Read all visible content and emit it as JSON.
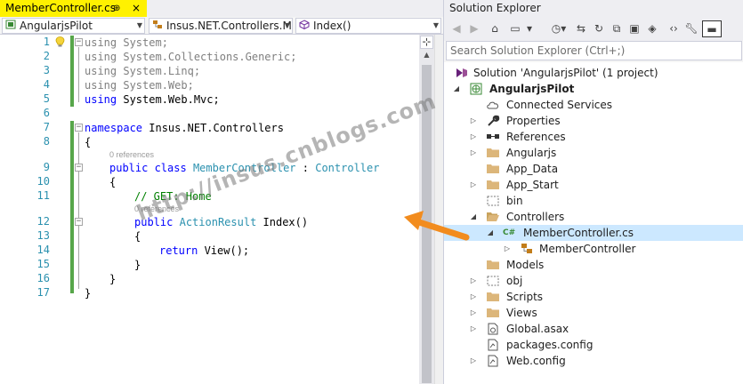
{
  "editor": {
    "tab": {
      "title": "MemberController.cs",
      "pin": "⊕",
      "close": "×"
    },
    "nav": {
      "project": "AngularjsPilot",
      "class": "Insus.NET.Controllers.M",
      "member": "Index()"
    },
    "line_numbers": [
      "1",
      "2",
      "3",
      "4",
      "5",
      "6",
      "7",
      "8",
      "9",
      "10",
      "11",
      "12",
      "13",
      "14",
      "15",
      "16",
      "17"
    ],
    "lines": [
      {
        "n": "1",
        "kind": "using-dim",
        "kw": "using",
        "rest": " System;"
      },
      {
        "n": "2",
        "kind": "using-dim",
        "kw": "using",
        "rest": " System.Collections.Generic;"
      },
      {
        "n": "3",
        "kind": "using-dim",
        "kw": "using",
        "rest": " System.Linq;"
      },
      {
        "n": "4",
        "kind": "using-dim",
        "kw": "using",
        "rest": " System.Web;"
      },
      {
        "n": "5",
        "kind": "using",
        "kw": "using",
        "rest": " System.Web.Mvc;"
      },
      {
        "n": "7",
        "kind": "ns",
        "kw": "namespace",
        "rest": " Insus.NET.Controllers"
      },
      {
        "n": "8",
        "kind": "brace",
        "text": "{"
      },
      {
        "n": "9",
        "kind": "class",
        "kw": "public class",
        "name": "MemberController",
        "sep": " : ",
        "base": "Controller"
      },
      {
        "n": "10",
        "kind": "brace",
        "text": "{"
      },
      {
        "n": "11",
        "kind": "comment",
        "text": "// GET: Home"
      },
      {
        "n": "12",
        "kind": "method",
        "kw": "public",
        "type": "ActionResult",
        "rest": " Index()"
      },
      {
        "n": "13",
        "kind": "brace",
        "text": "{"
      },
      {
        "n": "14",
        "kind": "return",
        "kw": "return",
        "rest": " View();"
      },
      {
        "n": "15",
        "kind": "brace",
        "text": "}"
      },
      {
        "n": "16",
        "kind": "brace",
        "text": "}"
      },
      {
        "n": "17",
        "kind": "brace",
        "text": "}"
      }
    ],
    "references_label": "0 references",
    "fold_minus": "−"
  },
  "solution_explorer": {
    "title": "Solution Explorer",
    "search_placeholder": "Search Solution Explorer (Ctrl+;)",
    "solution_label": "Solution 'AngularjsPilot' (1 project)",
    "project_label": "AngularjsPilot",
    "items": [
      {
        "label": "Connected Services",
        "icon": "cloud-icon"
      },
      {
        "label": "Properties",
        "icon": "wrench-icon"
      },
      {
        "label": "References",
        "icon": "references-icon"
      },
      {
        "label": "Angularjs",
        "icon": "folder-icon"
      },
      {
        "label": "App_Data",
        "icon": "folder-icon"
      },
      {
        "label": "App_Start",
        "icon": "folder-icon"
      },
      {
        "label": "bin",
        "icon": "dashed-folder-icon"
      },
      {
        "label": "Controllers",
        "icon": "folder-open-icon"
      },
      {
        "label": "MemberController.cs",
        "icon": "csharp-file-icon"
      },
      {
        "label": "MemberController",
        "icon": "class-icon"
      },
      {
        "label": "Models",
        "icon": "folder-icon"
      },
      {
        "label": "obj",
        "icon": "dashed-folder-icon"
      },
      {
        "label": "Scripts",
        "icon": "folder-icon"
      },
      {
        "label": "Views",
        "icon": "folder-icon"
      },
      {
        "label": "Global.asax",
        "icon": "asax-file-icon"
      },
      {
        "label": "packages.config",
        "icon": "config-file-icon"
      },
      {
        "label": "Web.config",
        "icon": "config-file-icon"
      }
    ],
    "csharp_badge": "C#"
  },
  "watermark": "http://insus.cnblogs.com",
  "colors": {
    "tab_active": "#fff100",
    "selection": "#cce8ff",
    "keyword": "#0000ff",
    "type": "#2b91af",
    "comment": "#008000",
    "arrow": "#f28c1e"
  }
}
